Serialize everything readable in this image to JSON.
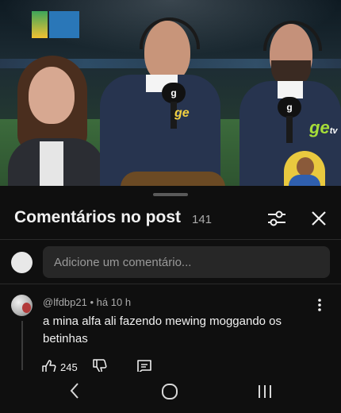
{
  "video": {
    "description_icons": [
      "tv-logo-icon",
      "ge-tv-logo-icon",
      "avatar-overlay-icon"
    ],
    "ge_mark": "ge",
    "ge_sub": "tv",
    "mic_label": "g"
  },
  "comments_sheet": {
    "title": "Comentários no post",
    "count": "141",
    "input_placeholder": "Adicione um comentário..."
  },
  "comment": {
    "author": "@lfdbp21",
    "separator": "•",
    "time": "há 10 h",
    "text": "a mina alfa ali fazendo mewing moggando os betinhas",
    "likes": "245"
  },
  "colors": {
    "background": "#0f0f0f",
    "input_bg": "#272727",
    "text_primary": "#f1f1f1",
    "text_secondary": "#aaaaaa"
  }
}
